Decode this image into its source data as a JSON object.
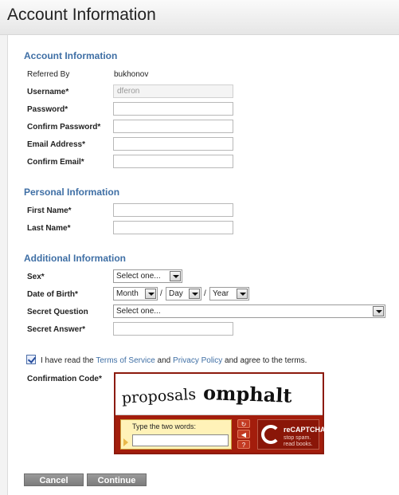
{
  "page_title": "Account Information",
  "account": {
    "title": "Account Information",
    "referred_by_label": "Referred By",
    "referred_by_value": "bukhonov",
    "username_label": "Username*",
    "username_value": "dferon",
    "password_label": "Password*",
    "confirm_password_label": "Confirm Password*",
    "email_label": "Email Address*",
    "confirm_email_label": "Confirm Email*"
  },
  "personal": {
    "title": "Personal Information",
    "first_name_label": "First Name*",
    "last_name_label": "Last Name*"
  },
  "additional": {
    "title": "Additional Information",
    "sex_label": "Sex*",
    "sex_value": "Select one...",
    "dob_label": "Date of Birth*",
    "dob_month": "Month",
    "dob_day": "Day",
    "dob_year": "Year",
    "dob_separator": "/",
    "secret_question_label": "Secret Question",
    "secret_question_value": "Select one...",
    "secret_answer_label": "Secret Answer*"
  },
  "terms": {
    "checked": true,
    "prefix": "I have read the ",
    "tos_link": "Terms of Service",
    "and": " and ",
    "privacy_link": "Privacy Policy",
    "suffix": " and agree to the terms."
  },
  "captcha": {
    "label": "Confirmation Code*",
    "words": [
      "proposals",
      "omphalt"
    ],
    "prompt": "Type the two words:",
    "brand": "reCAPTCHA™",
    "tagline_1": "stop spam.",
    "tagline_2": "read books.",
    "icons": [
      "refresh-icon",
      "audio-icon",
      "help-icon"
    ]
  },
  "buttons": {
    "cancel": "Cancel",
    "continue": "Continue"
  },
  "colors": {
    "section_title": "#3f6fa5",
    "button_bg": "#8a8a8a",
    "captcha_red": "#a31d0c"
  }
}
